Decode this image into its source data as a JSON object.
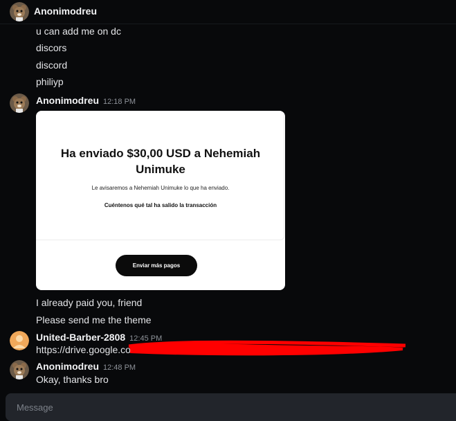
{
  "header": {
    "title": "Anonimodreu"
  },
  "messages": {
    "m1": "u can add me on dc",
    "m2": "discors",
    "m3": "discord",
    "m4": "philiyp"
  },
  "group1": {
    "author": "Anonimodreu",
    "time": "12:18 PM",
    "receipt": {
      "title": "Ha enviado $30,00 USD a Nehemiah Unimuke",
      "subtitle": "Le avisaremos a Nehemiah Unimuke lo que ha enviado.",
      "feedback_link": "Cuéntenos qué tal ha salido la transacción",
      "button": "Enviar más pagos"
    },
    "m5": "I already paid you, friend",
    "m6": "Please send me the theme"
  },
  "group2": {
    "author": "United-Barber-2808",
    "time": "12:45 PM",
    "link_visible": "https://drive.google.com"
  },
  "group3": {
    "author": "Anonimodreu",
    "time": "12:48 PM",
    "m7": "Okay, thanks bro"
  },
  "composer": {
    "placeholder": "Message"
  },
  "colors": {
    "background": "#08090b",
    "redaction": "#ff0000",
    "composer": "#22252b"
  },
  "icons": {
    "anon_avatar": "bear-avatar-icon",
    "user_avatar": "orange-user-avatar-icon"
  }
}
